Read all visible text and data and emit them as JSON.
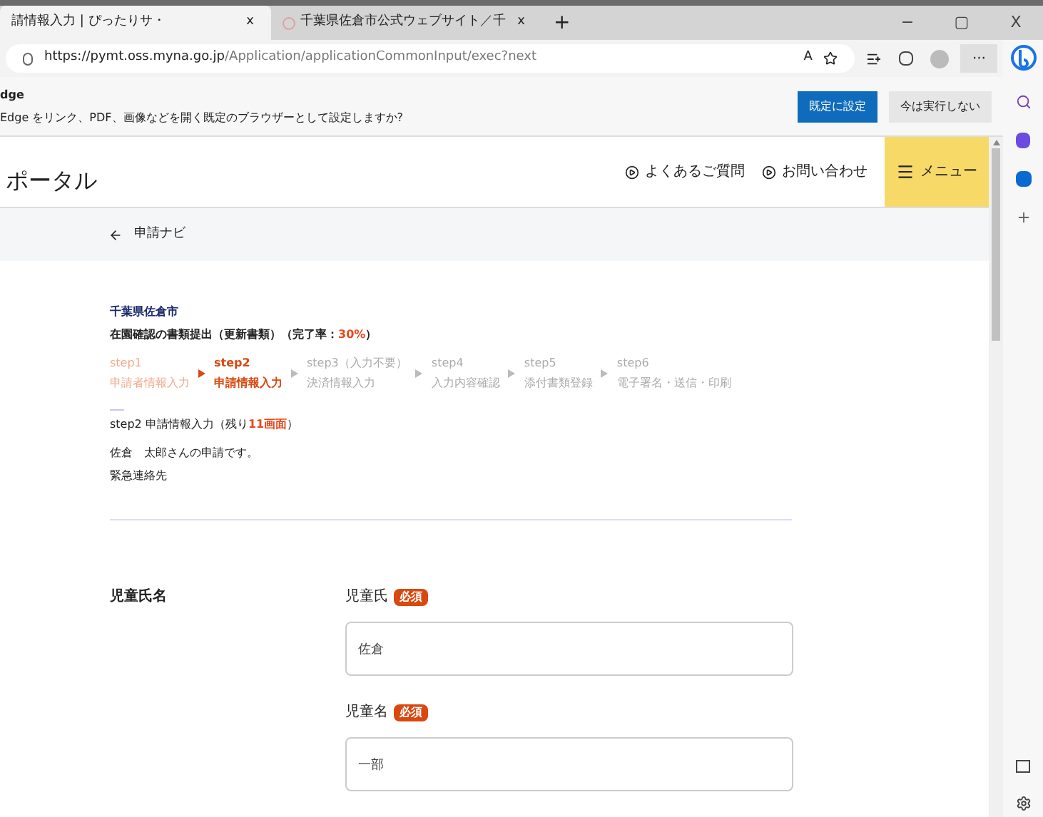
{
  "browser": {
    "tabs": [
      {
        "title": "請情報入力 | ぴったりサ・",
        "selected": true,
        "close": "x"
      },
      {
        "title": "千葉県佐倉市公式ウェブサイト／千",
        "selected": false,
        "close": "x"
      }
    ],
    "new_tab": "+",
    "window_controls": [
      "−",
      "▢",
      "X"
    ],
    "url": {
      "host": "https://pymt.oss.myna.go.jp",
      "path": "/Application/applicationCommonInput/exec?next"
    },
    "read_aloud": "A",
    "more": "···"
  },
  "infobar": {
    "title": "dge",
    "message": "Edge をリンク、PDF、画像などを開く既定のブラウザーとして設定しますか?",
    "buttons": [
      {
        "label": "既定に設定",
        "primary": true
      },
      {
        "label": "今は実行しない",
        "primary": false
      }
    ]
  },
  "site_header": {
    "logo": "ポータル",
    "links": [
      "よくあるご質問",
      "お問い合わせ"
    ],
    "menu": "メニュー"
  },
  "nav": {
    "back": "申請ナビ"
  },
  "application": {
    "municipality": "千葉県佐倉市",
    "title": {
      "text": "在園確認の書類提出（更新書類）（完了率：",
      "highlight": "30%",
      "suffix": "）"
    },
    "steps": [
      {
        "label": "step1",
        "name": "申請者情報入力",
        "selected": false,
        "done": true
      },
      {
        "label": "step2",
        "name": "申請情報入力",
        "selected": true,
        "done": false
      },
      {
        "label": "step3（入力不要）",
        "name": "決済情報入力",
        "selected": false,
        "done": false
      },
      {
        "label": "step4",
        "name": "入力内容確認",
        "selected": false,
        "done": false
      },
      {
        "label": "step5",
        "name": "添付書類登録",
        "selected": false,
        "done": false
      },
      {
        "label": "step6",
        "name": "電子署名・送信・印刷",
        "selected": false,
        "done": false
      }
    ],
    "current": {
      "text": "step2 申請情報入力（残り",
      "highlight": "11画面",
      "suffix": "）"
    },
    "applicant": "佐倉　太郎さんの申請です。",
    "section": "緊急連絡先"
  },
  "form": {
    "group_label": "児童氏名",
    "fields": [
      {
        "label": "児童氏",
        "badge": "必須",
        "value": "佐倉"
      },
      {
        "label": "児童名",
        "badge": "必須",
        "value": "一部"
      }
    ]
  }
}
